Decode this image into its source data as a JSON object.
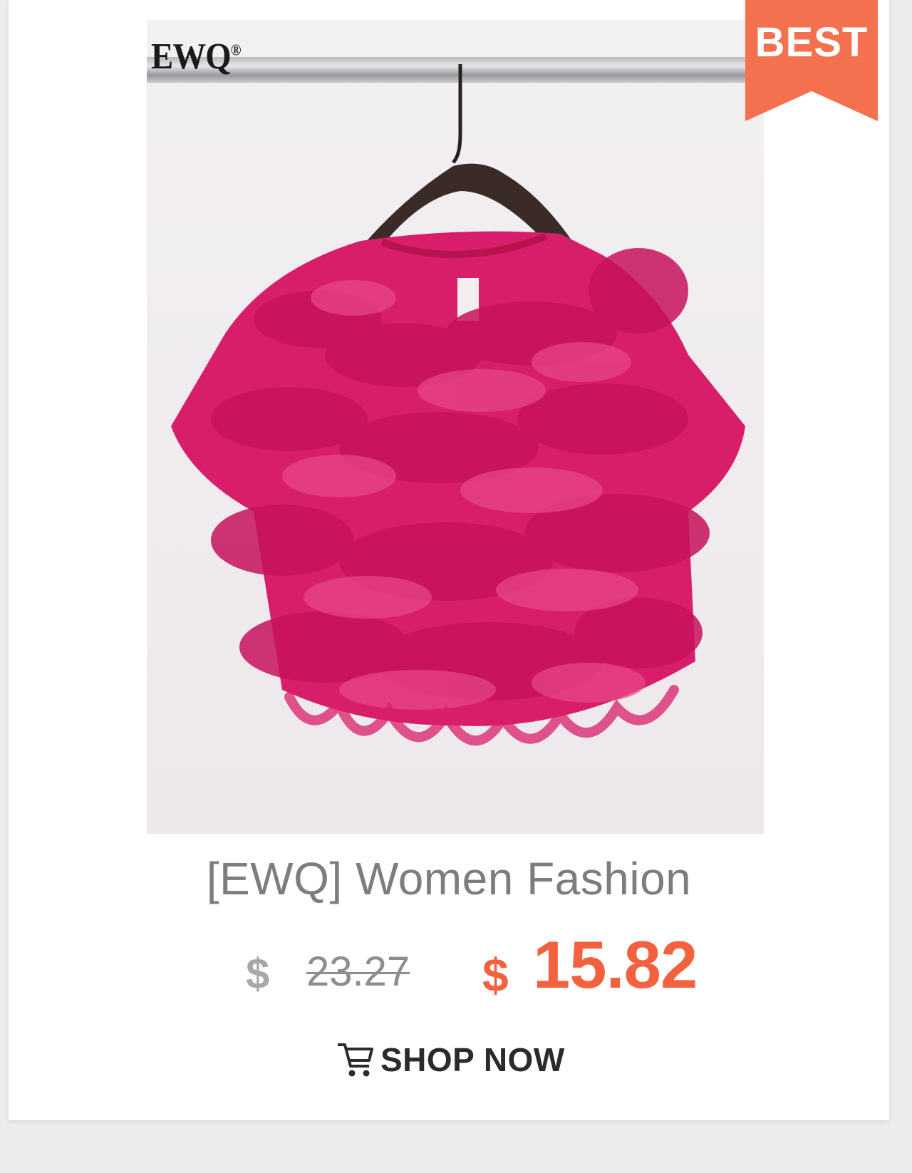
{
  "product": {
    "brand_logo": "EWQ",
    "brand_logo_mark": "®",
    "badge": "BEST",
    "title": "[EWQ] Women Fashion",
    "old_currency": "$",
    "old_price": "23.27",
    "new_currency": "$",
    "new_price": "15.82",
    "cta_label": "SHOP NOW",
    "cta_icon": "cart-icon"
  },
  "colors": {
    "accent": "#f2623f",
    "garment": "#d81e6a",
    "badge": "#f3714f",
    "card_bg": "#ffffff",
    "page_bg": "#ececec"
  }
}
